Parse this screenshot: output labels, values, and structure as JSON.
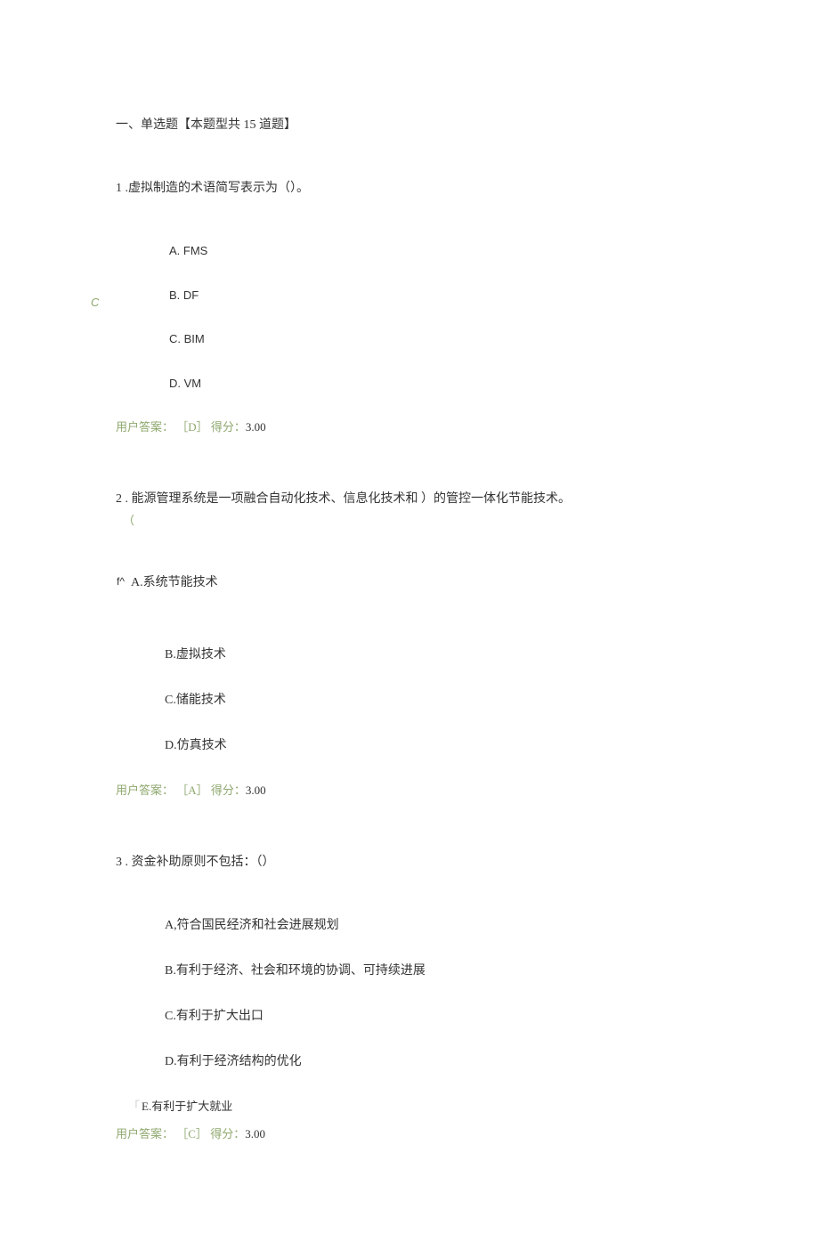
{
  "section": {
    "title": "一、单选题【本题型共 15 道题】"
  },
  "questions": [
    {
      "number": "1",
      "text": " .虚拟制造的术语简写表示为（）。",
      "marker": "C",
      "options": [
        "A.    FMS",
        "B.    DF",
        "C.    BIM",
        "D.    VM"
      ],
      "answer": {
        "prefix": "用户答案：",
        "value": "［D］",
        "score_label": "得分：",
        "score": "3.00"
      }
    },
    {
      "number": "2",
      "text": " . 能源管理系统是一项融合自动化技术、信息化技术和   ）的管控一体化节能技术。",
      "paren": "（",
      "option_a_prefix": "f^",
      "options": [
        "A.系统节能技术",
        "B.虚拟技术",
        "C.储能技术",
        "D.仿真技术"
      ],
      "answer": {
        "prefix": "用户答案：",
        "value": "［A］",
        "score_label": "得分：",
        "score": "3.00"
      }
    },
    {
      "number": "3",
      "text": " . 资金补助原则不包括：（）",
      "options": [
        "A,符合国民经济和社会进展规划",
        "B.有利于经济、社会和环境的协调、可持续进展",
        "C.有利于扩大出口",
        "D.有利于经济结构的优化"
      ],
      "option_e_bracket": "「",
      "option_e": "E.有利于扩大就业",
      "answer": {
        "prefix": "用户答案：",
        "value": "［C］",
        "score_label": "得分：",
        "score": "3.00"
      }
    }
  ]
}
